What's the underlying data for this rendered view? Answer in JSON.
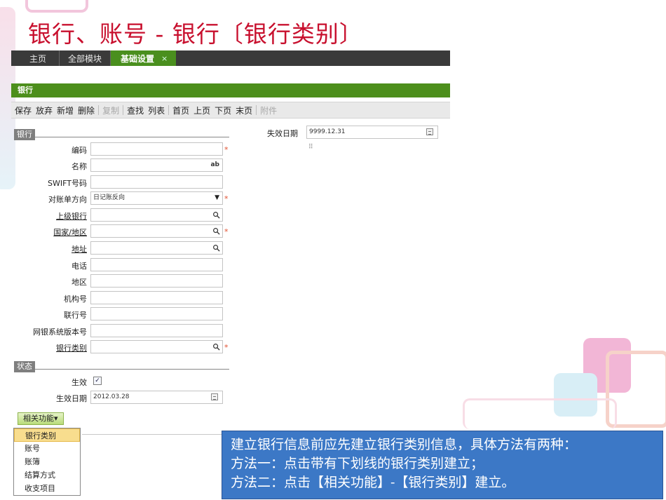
{
  "slide_title": "银行、账号 - 银行〔银行类别〕",
  "tabs": [
    {
      "label": "主页"
    },
    {
      "label": "全部模块"
    },
    {
      "label": "基础设置",
      "active": true,
      "close": "×"
    }
  ],
  "section_title": "银行",
  "toolbar": {
    "buttons": [
      "保存",
      "放弃",
      "新增",
      "删除",
      "复制",
      "查找",
      "列表",
      "首页",
      "上页",
      "下页",
      "末页",
      "附件"
    ],
    "disabled": [
      "复制",
      "附件"
    ]
  },
  "group_bank": "银行",
  "fields": {
    "code": {
      "label": "编码",
      "value": "",
      "required": true
    },
    "name": {
      "label": "名称",
      "value": "",
      "suffix": "ab"
    },
    "swift": {
      "label": "SWIFT号码",
      "value": ""
    },
    "statement_direction": {
      "label": "对账单方向",
      "value": "日记账反向",
      "required": true
    },
    "parent_bank": {
      "label": "上级银行",
      "value": ""
    },
    "country": {
      "label": "国家/地区",
      "value": "",
      "required": true
    },
    "address": {
      "label": "地址",
      "value": ""
    },
    "phone": {
      "label": "电话",
      "value": ""
    },
    "region": {
      "label": "地区",
      "value": ""
    },
    "institution_no": {
      "label": "机构号",
      "value": ""
    },
    "union_no": {
      "label": "联行号",
      "value": ""
    },
    "netbank_version": {
      "label": "网银系统版本号",
      "value": ""
    },
    "bank_category": {
      "label": "银行类别",
      "value": "",
      "required": true
    }
  },
  "required_mark": "*",
  "expiry": {
    "label": "失效日期",
    "value": "9999.12.31"
  },
  "group_status": "状态",
  "status": {
    "effective_label": "生效",
    "effective_checked": "✓",
    "effective_date_label": "生效日期",
    "effective_date_value": "2012.03.28"
  },
  "related_button": "相关功能▾",
  "related_menu": [
    "银行类别",
    "账号",
    "账簿",
    "结算方式",
    "收支项目"
  ],
  "note": [
    "建立银行信息前应先建立银行类别信息，具体方法有两种：",
    "方法一：点击带有下划线的银行类别建立；",
    "方法二：点击【相关功能】-【银行类别】建立。"
  ]
}
